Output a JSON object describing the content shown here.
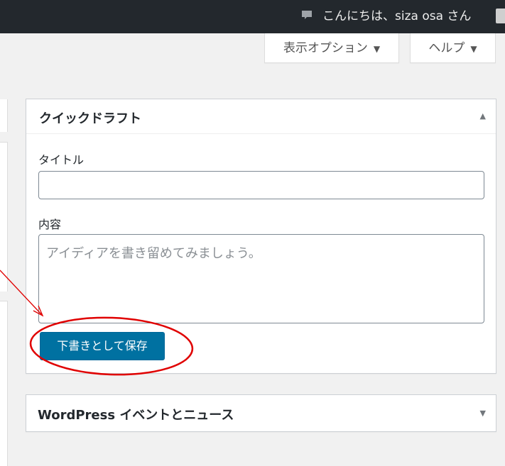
{
  "adminbar": {
    "greeting": "こんにちは、siza osa さん",
    "comment_icon": "comment-icon"
  },
  "screen_meta": {
    "options_label": "表示オプション",
    "help_label": "ヘルプ",
    "arrow": "▼"
  },
  "quick_draft": {
    "title": "クイックドラフト",
    "toggle_icon": "▲",
    "title_label": "タイトル",
    "title_value": "",
    "content_label": "内容",
    "content_placeholder": "アイディアを書き留めてみましょう。",
    "save_button": "下書きとして保存"
  },
  "events_news": {
    "title": "WordPress イベントとニュース",
    "toggle_icon": "▼"
  },
  "annotation": {
    "color": "#e00000",
    "shapes": [
      "arrow",
      "ellipse"
    ]
  }
}
